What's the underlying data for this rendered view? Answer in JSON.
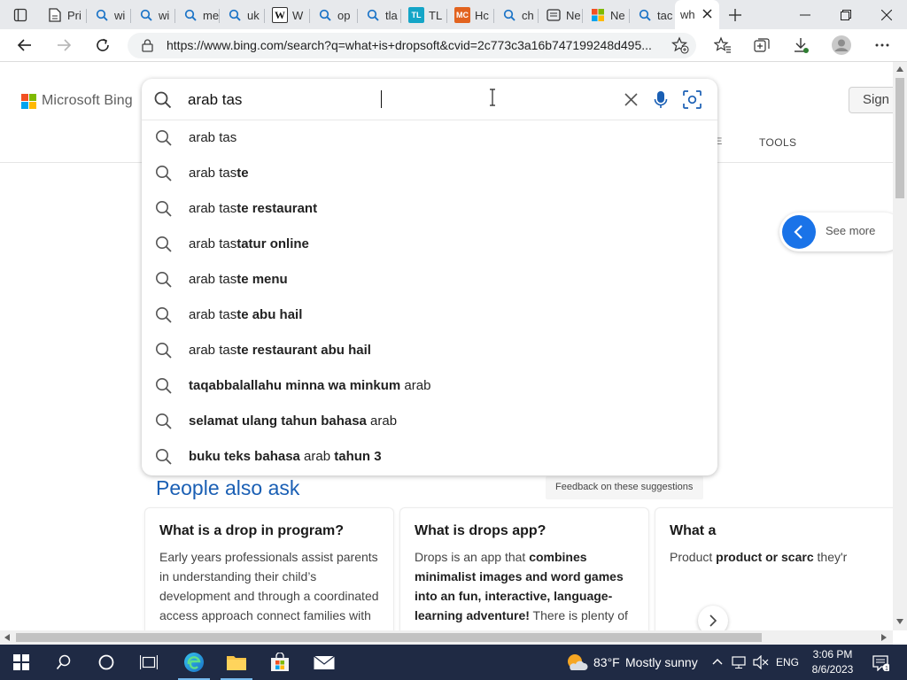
{
  "browser": {
    "tabs": [
      {
        "label": "Pri",
        "icon": "page-icon"
      },
      {
        "label": "wi",
        "icon": "search-icon"
      },
      {
        "label": "wi",
        "icon": "search-icon"
      },
      {
        "label": "me",
        "icon": "search-icon"
      },
      {
        "label": "uk",
        "icon": "search-icon"
      },
      {
        "label": "W",
        "icon": "wikipedia-icon"
      },
      {
        "label": "op",
        "icon": "search-icon"
      },
      {
        "label": "tla",
        "icon": "search-icon"
      },
      {
        "label": "TL",
        "icon": "tl-icon"
      },
      {
        "label": "Hc",
        "icon": "mc-icon"
      },
      {
        "label": "ch",
        "icon": "search-icon"
      },
      {
        "label": "Ne",
        "icon": "news-icon"
      },
      {
        "label": "Ne",
        "icon": "microsoft-icon"
      },
      {
        "label": "tac",
        "icon": "search-icon"
      },
      {
        "label": "wh",
        "icon": "none",
        "active": true
      }
    ],
    "tl_badge": "TL",
    "mc_badge": "MC",
    "url": "https://www.bing.com/search?q=what+is+dropsoft&cvid=2c773c3a16b747199248d495..."
  },
  "bing": {
    "logo_text": "Microsoft Bing",
    "sign_in": "Sign i",
    "tools_fragment": "E",
    "tools": "TOOLS",
    "see_more": "See more",
    "search": {
      "value": "arab tas",
      "suggestions": [
        {
          "parts": [
            {
              "t": "arab tas",
              "b": false
            }
          ]
        },
        {
          "parts": [
            {
              "t": "arab tas",
              "b": false
            },
            {
              "t": "te",
              "b": true
            }
          ]
        },
        {
          "parts": [
            {
              "t": "arab tas",
              "b": false
            },
            {
              "t": "te restaurant",
              "b": true
            }
          ]
        },
        {
          "parts": [
            {
              "t": "arab tas",
              "b": false
            },
            {
              "t": "tatur online",
              "b": true
            }
          ]
        },
        {
          "parts": [
            {
              "t": "arab tas",
              "b": false
            },
            {
              "t": "te menu",
              "b": true
            }
          ]
        },
        {
          "parts": [
            {
              "t": "arab tas",
              "b": false
            },
            {
              "t": "te abu hail",
              "b": true
            }
          ]
        },
        {
          "parts": [
            {
              "t": "arab tas",
              "b": false
            },
            {
              "t": "te restaurant abu hail",
              "b": true
            }
          ]
        },
        {
          "parts": [
            {
              "t": "taqabbalallahu minna wa minkum",
              "b": true
            },
            {
              "t": " arab",
              "b": false
            }
          ]
        },
        {
          "parts": [
            {
              "t": "selamat ulang tahun bahasa",
              "b": true
            },
            {
              "t": " arab",
              "b": false
            }
          ]
        },
        {
          "parts": [
            {
              "t": "buku teks bahasa",
              "b": true
            },
            {
              "t": " arab ",
              "b": false
            },
            {
              "t": "tahun 3",
              "b": true
            }
          ]
        }
      ]
    },
    "people_also_ask": {
      "title": "People also ask",
      "feedback": "Feedback on these suggestions",
      "cards": [
        {
          "question": "What is a drop in program?",
          "answer": [
            {
              "t": "Early years professionals assist parents in understanding their child’s development and through a coordinated access approach connect families with",
              "b": false
            }
          ]
        },
        {
          "question": "What is drops app?",
          "answer": [
            {
              "t": "Drops is an app that ",
              "b": false
            },
            {
              "t": "combines minimalist images and word games into an fun, interactive, language-learning adventure!",
              "b": true
            },
            {
              "t": " There is plenty of",
              "b": false
            }
          ]
        },
        {
          "question": "What a",
          "answer": [
            {
              "t": "Product",
              "b": false
            },
            {
              "t": " product or scarc",
              "b": true
            },
            {
              "t": " they'r",
              "b": false
            }
          ]
        }
      ]
    }
  },
  "taskbar": {
    "weather_temp": "83°F",
    "weather_desc": "Mostly sunny",
    "language": "ENG",
    "time": "3:06 PM",
    "date": "8/6/2023"
  },
  "colors": {
    "bing_blue": "#1a5fb4",
    "accent_blue": "#1a73e8",
    "taskbar": "#1f2a44"
  }
}
